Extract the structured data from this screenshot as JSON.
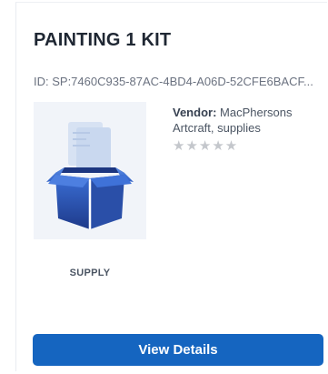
{
  "card": {
    "title": "PAINTING 1 KIT",
    "id_text": "ID: SP:7460C935-87AC-4BD4-A06D-52CFE6BACF...",
    "vendor_label": "Vendor:",
    "vendor_name": "MacPhersons Artcraft, supplies",
    "rating": {
      "value": 0,
      "max": 5,
      "display": "★★★★★"
    },
    "type_label": "SUPPLY",
    "thumbnail_icon": "open-box-icon",
    "view_button_label": "View Details"
  },
  "colors": {
    "accent": "#1565c0",
    "title_text": "#1f2733",
    "muted_text": "#6b7280",
    "star_empty": "#c4c7cc",
    "thumb_bg": "#f1f4f9",
    "box_dark": "#1e3a8a",
    "box_light": "#3b6fd6"
  }
}
